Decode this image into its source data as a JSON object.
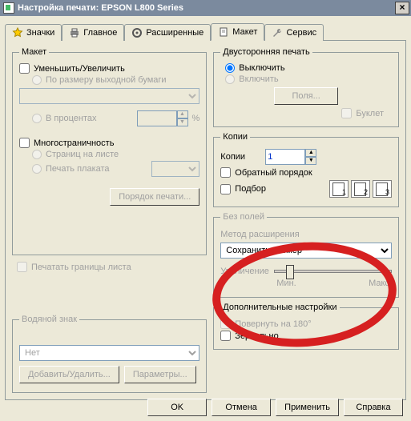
{
  "window": {
    "title": "Настройка печати: EPSON L800 Series"
  },
  "tabs": {
    "icons": "Значки",
    "main": "Главное",
    "advanced": "Расширенные",
    "layout": "Макет",
    "service": "Сервис"
  },
  "layout_group": {
    "legend": "Макет",
    "reduce_enlarge": "Уменьшить/Увеличить",
    "fit_output": "По размеру выходной бумаги",
    "percent": "В процентах",
    "percent_unit": "%",
    "multipage": "Многостраничность",
    "pages_per_sheet": "Страниц на листе",
    "poster": "Печать плаката",
    "print_order_btn": "Порядок печати...",
    "print_borders": "Печатать границы листа"
  },
  "duplex": {
    "legend": "Двусторонняя печать",
    "off": "Выключить",
    "on": "Включить",
    "margins_btn": "Поля...",
    "booklet": "Буклет"
  },
  "copies": {
    "legend": "Копии",
    "label": "Копии",
    "value": "1",
    "reverse": "Обратный порядок",
    "collate": "Подбор",
    "icon1": "1",
    "icon2": "2",
    "icon3": "3"
  },
  "borderless": {
    "legend": "Без полей",
    "method_label": "Метод расширения",
    "method_value": "Сохранить размер",
    "enlarge": "Увеличение",
    "min": "Мин.",
    "max": "Макс."
  },
  "watermark": {
    "legend": "Водяной знак",
    "value": "Нет",
    "add_btn": "Добавить/Удалить...",
    "params_btn": "Параметры..."
  },
  "extra": {
    "legend": "Дополнительные настройки",
    "rotate": "Повернуть на 180°",
    "mirror": "Зеркально"
  },
  "buttons": {
    "ok": "OK",
    "cancel": "Отмена",
    "apply": "Применить",
    "help": "Справка"
  }
}
